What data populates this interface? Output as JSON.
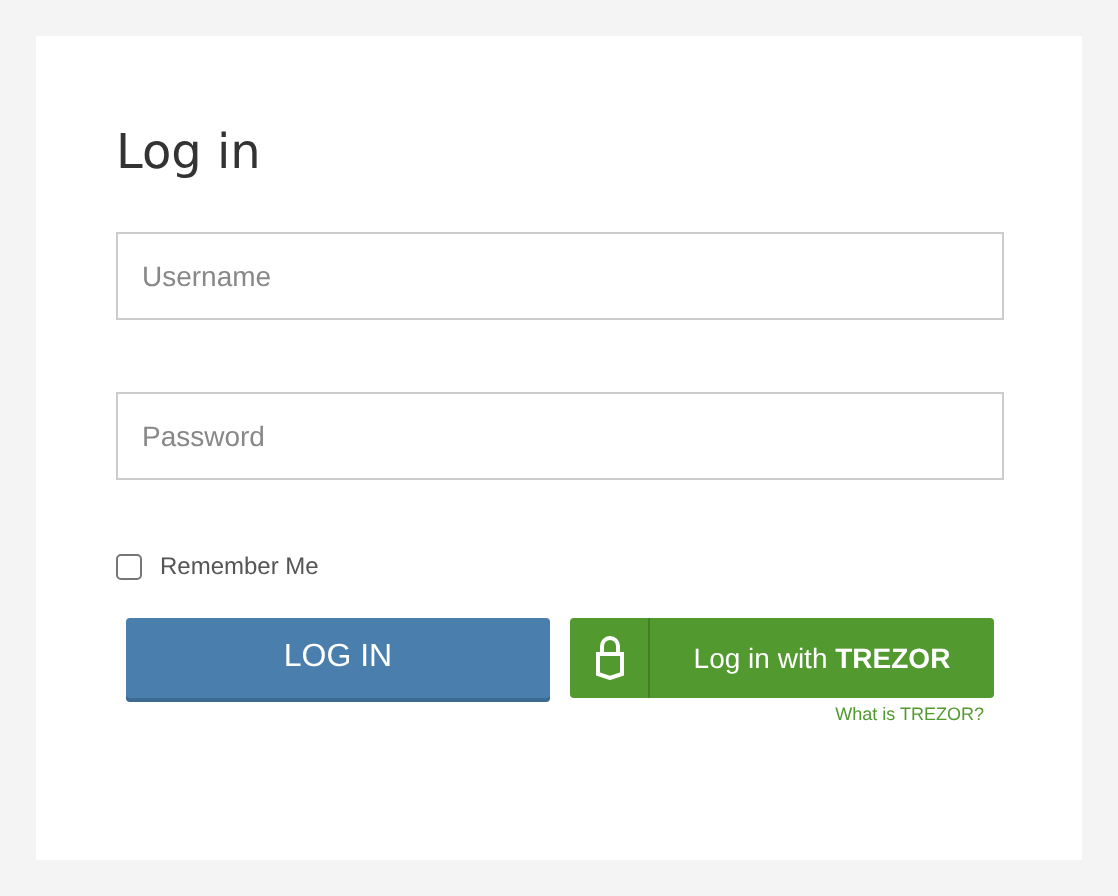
{
  "title": "Log in",
  "fields": [
    {
      "placeholder": "Username"
    },
    {
      "placeholder": "Password"
    }
  ],
  "remember": {
    "label": "Remember Me",
    "checked": false
  },
  "login_button": "LOG IN",
  "trezor_button": "Log in with **TREZOR**",
  "trezor_link": "What is TREZOR?"
}
